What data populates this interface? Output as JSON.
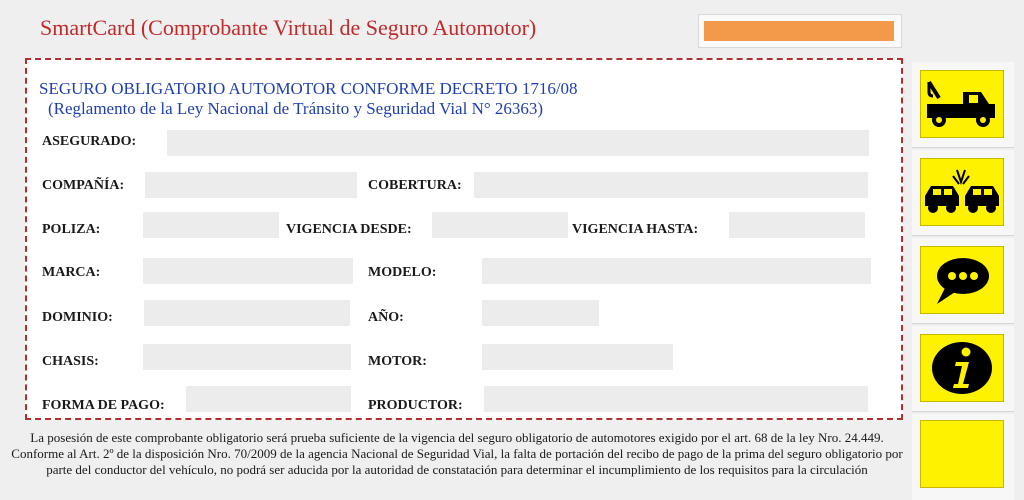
{
  "header": {
    "title": "SmartCard (Comprobante Virtual de Seguro Automotor)",
    "accent_color": "#f29a4a",
    "title_color": "#c12a2a"
  },
  "card": {
    "heading": "SEGURO OBLIGATORIO AUTOMOTOR CONFORME DECRETO 1716/08",
    "subheading": "(Reglamento de la Ley  Nacional de Tránsito y Seguridad Vial N° 26363)",
    "fields": {
      "asegurado": {
        "label": "ASEGURADO:",
        "value": ""
      },
      "compania": {
        "label": "COMPAÑÍA:",
        "value": ""
      },
      "cobertura": {
        "label": "COBERTURA:",
        "value": ""
      },
      "poliza": {
        "label": "POLIZA:",
        "value": ""
      },
      "vigencia_desde": {
        "label": "VIGENCIA DESDE:",
        "value": ""
      },
      "vigencia_hasta": {
        "label": "VIGENCIA HASTA:",
        "value": ""
      },
      "marca": {
        "label": "MARCA:",
        "value": ""
      },
      "modelo": {
        "label": "MODELO:",
        "value": ""
      },
      "dominio": {
        "label": "DOMINIO:",
        "value": ""
      },
      "anio": {
        "label": "AÑO:",
        "value": ""
      },
      "chasis": {
        "label": "CHASIS:",
        "value": ""
      },
      "motor": {
        "label": "MOTOR:",
        "value": ""
      },
      "forma_pago": {
        "label": "FORMA DE PAGO:",
        "value": ""
      },
      "productor": {
        "label": "PRODUCTOR:",
        "value": ""
      }
    }
  },
  "sidebar": {
    "buttons": [
      {
        "icon": "tow-truck-icon"
      },
      {
        "icon": "car-crash-icon"
      },
      {
        "icon": "chat-bubble-icon"
      },
      {
        "icon": "info-icon"
      },
      {
        "icon": "blank"
      }
    ],
    "button_color": "#fff200"
  },
  "footer": {
    "text": "La posesión de este comprobante obligatorio será prueba suficiente de la vigencia del seguro obligatorio de automotores exigido por el art. 68 de la ley Nro. 24.449. Conforme al Art. 2º de la disposición Nro. 70/2009 de la agencia Nacional de Seguridad Vial, la falta de portación del recibo de pago de la prima del seguro obligatorio por parte del conductor del vehículo, no podrá ser aducida por la autoridad de constatación para determinar el incumplimiento de los requisitos para la circulación"
  }
}
